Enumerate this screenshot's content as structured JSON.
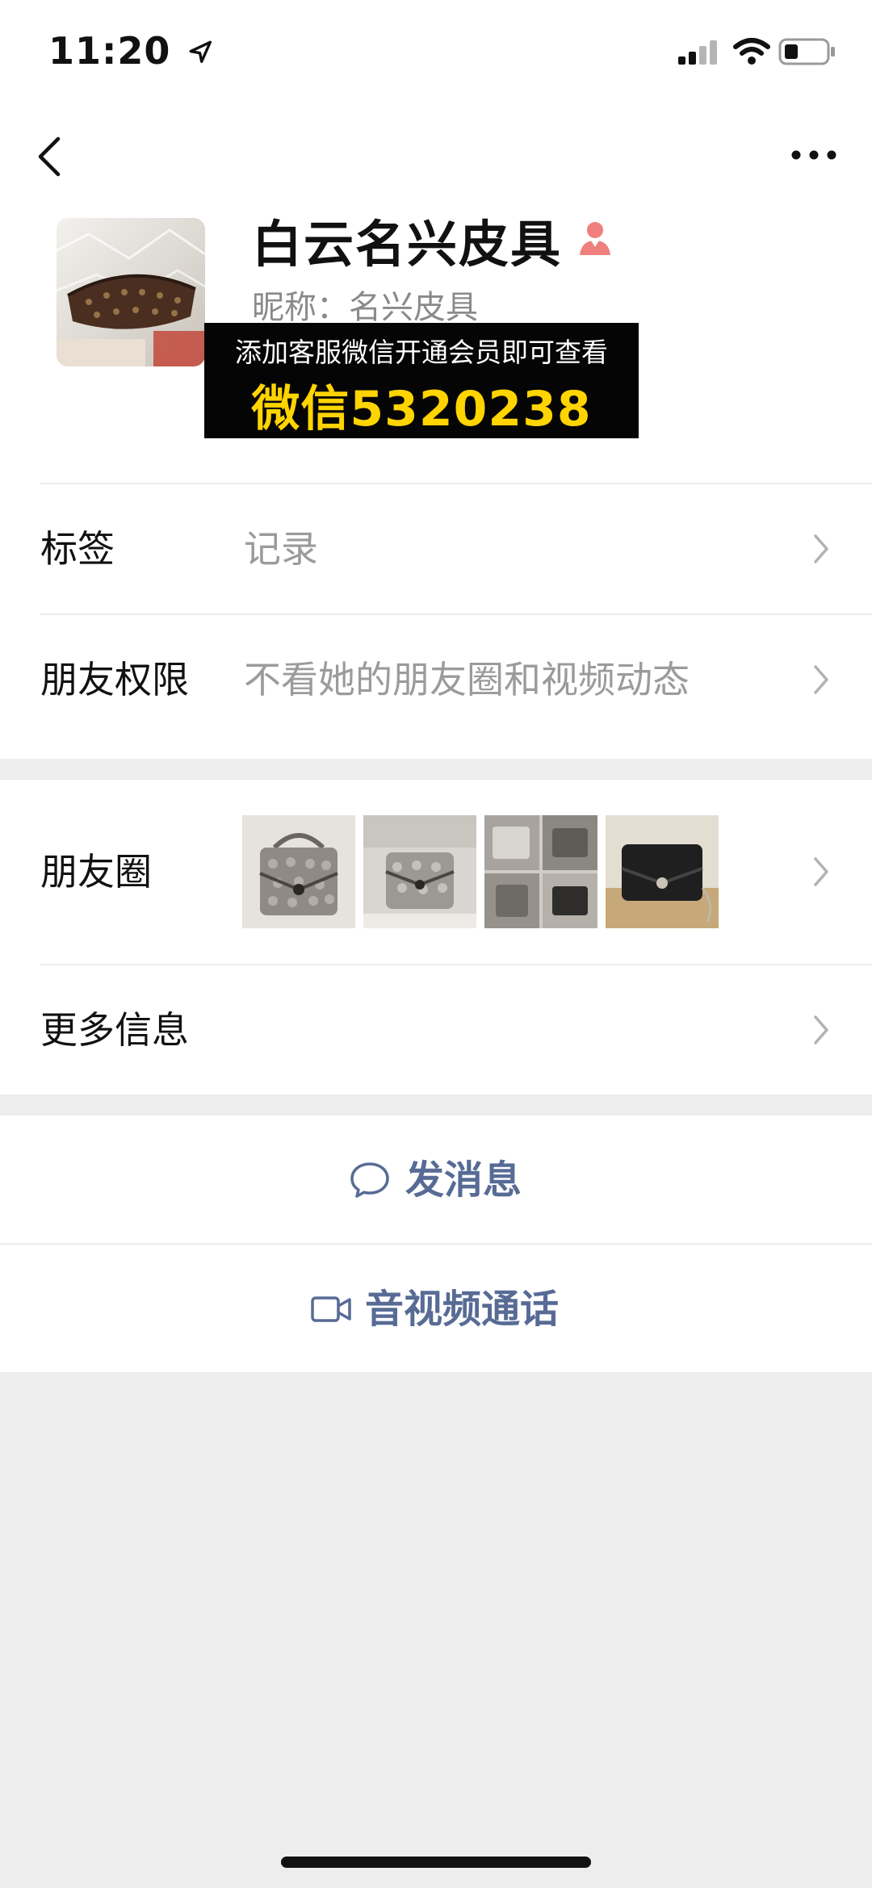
{
  "status_bar": {
    "time": "11:20"
  },
  "profile": {
    "name": "白云名兴皮具",
    "nickname": "昵称：名兴皮具",
    "gender": "female"
  },
  "ad_banner": {
    "line1": "添加客服微信开通会员即可查看",
    "line2": "微信5320238"
  },
  "rows": {
    "tags": {
      "label": "标签",
      "value": "记录"
    },
    "permissions": {
      "label": "朋友权限",
      "value": "不看她的朋友圈和视频动态"
    },
    "moments": {
      "label": "朋友圈"
    },
    "more_info": {
      "label": "更多信息"
    }
  },
  "actions": {
    "send_message": "发消息",
    "video_call": "音视频通话"
  },
  "colors": {
    "accent": "#576b95",
    "ad_yellow": "#ffd400",
    "female_icon": "#f0807d"
  },
  "icons": {
    "back": "chevron-left-icon",
    "more": "more-dots-icon",
    "gender": "female-icon",
    "row_arrow": "chevron-right-icon",
    "message": "chat-bubble-icon",
    "video": "video-camera-icon"
  }
}
